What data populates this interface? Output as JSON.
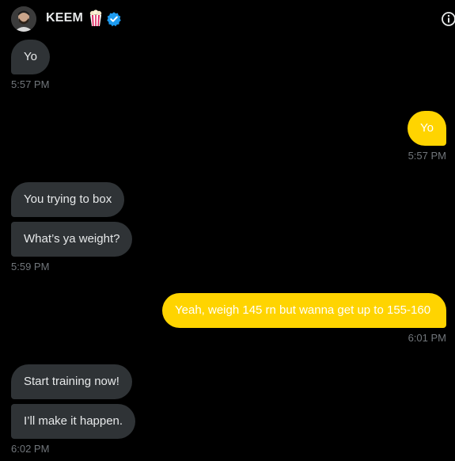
{
  "header": {
    "name": "KEEM",
    "avatar_icon": "profile-avatar",
    "popcorn_icon": "popcorn-emoji",
    "verified_icon": "verified-badge",
    "info_icon": "info-icon",
    "verified_color": "#1d9bf0"
  },
  "colors": {
    "background": "#000000",
    "incoming_bubble": "#2f3336",
    "outgoing_bubble": "#ffd400",
    "timestamp": "#71767b"
  },
  "messages": [
    {
      "direction": "incoming",
      "text": "Yo"
    },
    {
      "direction": "outgoing",
      "text": "Yo"
    },
    {
      "direction": "incoming",
      "text": "You trying to box"
    },
    {
      "direction": "incoming",
      "text": "What’s ya weight?"
    },
    {
      "direction": "outgoing",
      "text": "Yeah, weigh 145 rn but wanna get up to 155-160"
    },
    {
      "direction": "incoming",
      "text": "Start training now!"
    },
    {
      "direction": "incoming",
      "text": "I’ll make it happen."
    }
  ],
  "timestamps": [
    "5:57 PM",
    "5:57 PM",
    "5:59 PM",
    "6:01 PM",
    "6:02 PM"
  ]
}
